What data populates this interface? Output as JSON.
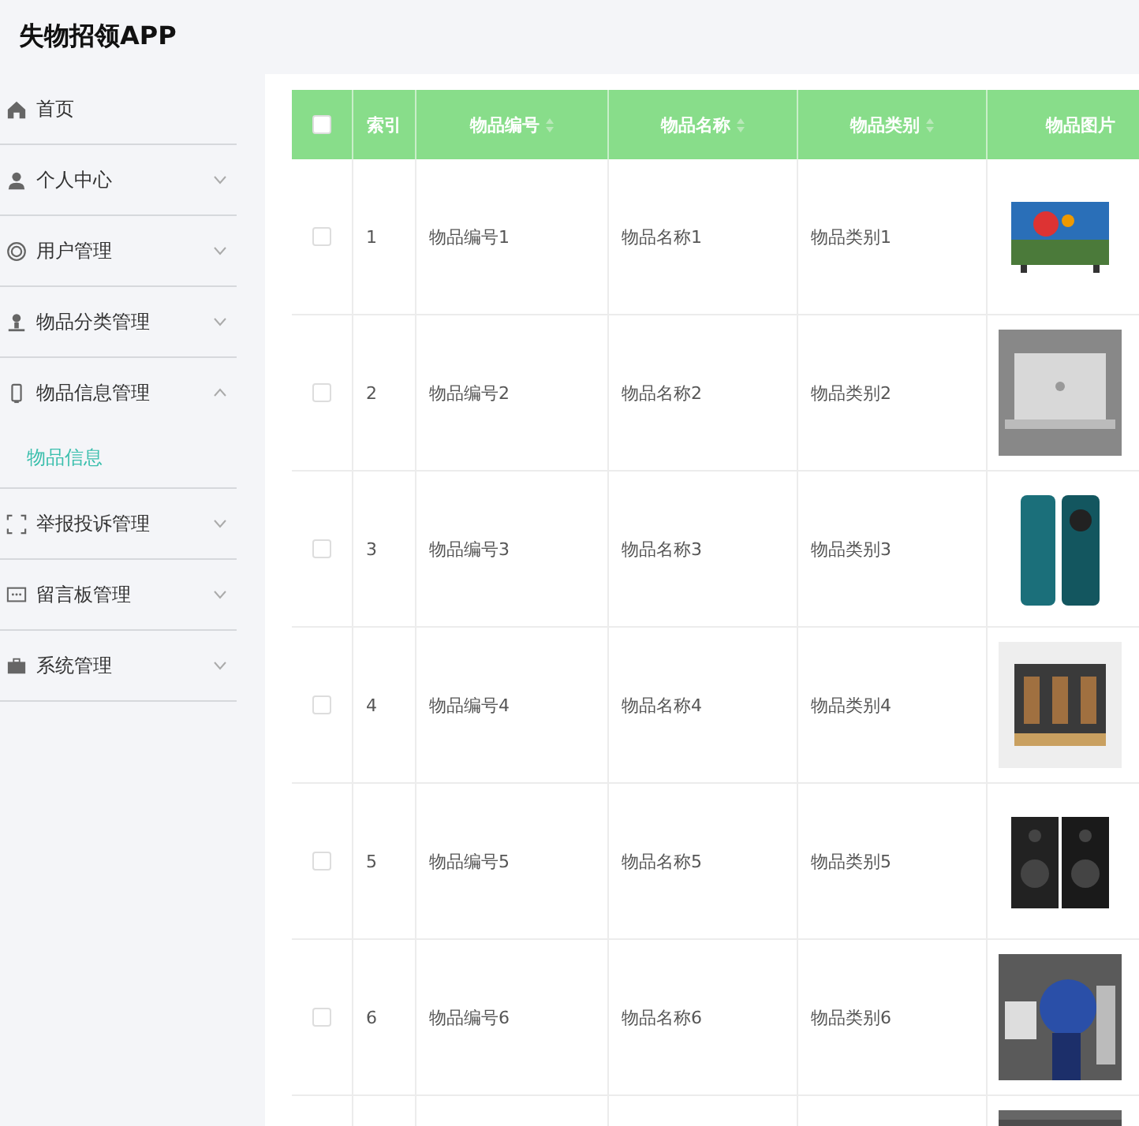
{
  "app_title": "失物招领APP",
  "sidebar": {
    "items": [
      {
        "label": "首页"
      },
      {
        "label": "个人中心",
        "expanded": false
      },
      {
        "label": "用户管理",
        "expanded": false
      },
      {
        "label": "物品分类管理",
        "expanded": false
      },
      {
        "label": "物品信息管理",
        "expanded": true,
        "children": [
          {
            "label": "物品信息",
            "selected": true
          }
        ]
      },
      {
        "label": "举报投诉管理",
        "expanded": false
      },
      {
        "label": "留言板管理",
        "expanded": false
      },
      {
        "label": "系统管理",
        "expanded": false
      }
    ]
  },
  "table": {
    "select_all_checked": false,
    "columns": [
      {
        "label": "索引",
        "sortable": false
      },
      {
        "label": "物品编号",
        "sortable": true
      },
      {
        "label": "物品名称",
        "sortable": true
      },
      {
        "label": "物品类别",
        "sortable": true
      },
      {
        "label": "物品图片",
        "sortable": false
      }
    ],
    "rows": [
      {
        "checked": false,
        "index": "1",
        "code": "物品编号1",
        "name": "物品名称1",
        "category": "物品类别1",
        "image": {
          "kind": "picture"
        }
      },
      {
        "checked": false,
        "index": "2",
        "code": "物品编号2",
        "name": "物品名称2",
        "category": "物品类别2",
        "image": {
          "kind": "picture"
        }
      },
      {
        "checked": false,
        "index": "3",
        "code": "物品编号3",
        "name": "物品名称3",
        "category": "物品类别3",
        "image": {
          "kind": "picture"
        }
      },
      {
        "checked": false,
        "index": "4",
        "code": "物品编号4",
        "name": "物品名称4",
        "category": "物品类别4",
        "image": {
          "kind": "picture"
        }
      },
      {
        "checked": false,
        "index": "5",
        "code": "物品编号5",
        "name": "物品名称5",
        "category": "物品类别5",
        "image": {
          "kind": "picture"
        }
      },
      {
        "checked": false,
        "index": "6",
        "code": "物品编号6",
        "name": "物品名称6",
        "category": "物品类别6",
        "image": {
          "kind": "picture"
        }
      },
      {
        "image": {
          "kind": "picture"
        }
      }
    ]
  }
}
